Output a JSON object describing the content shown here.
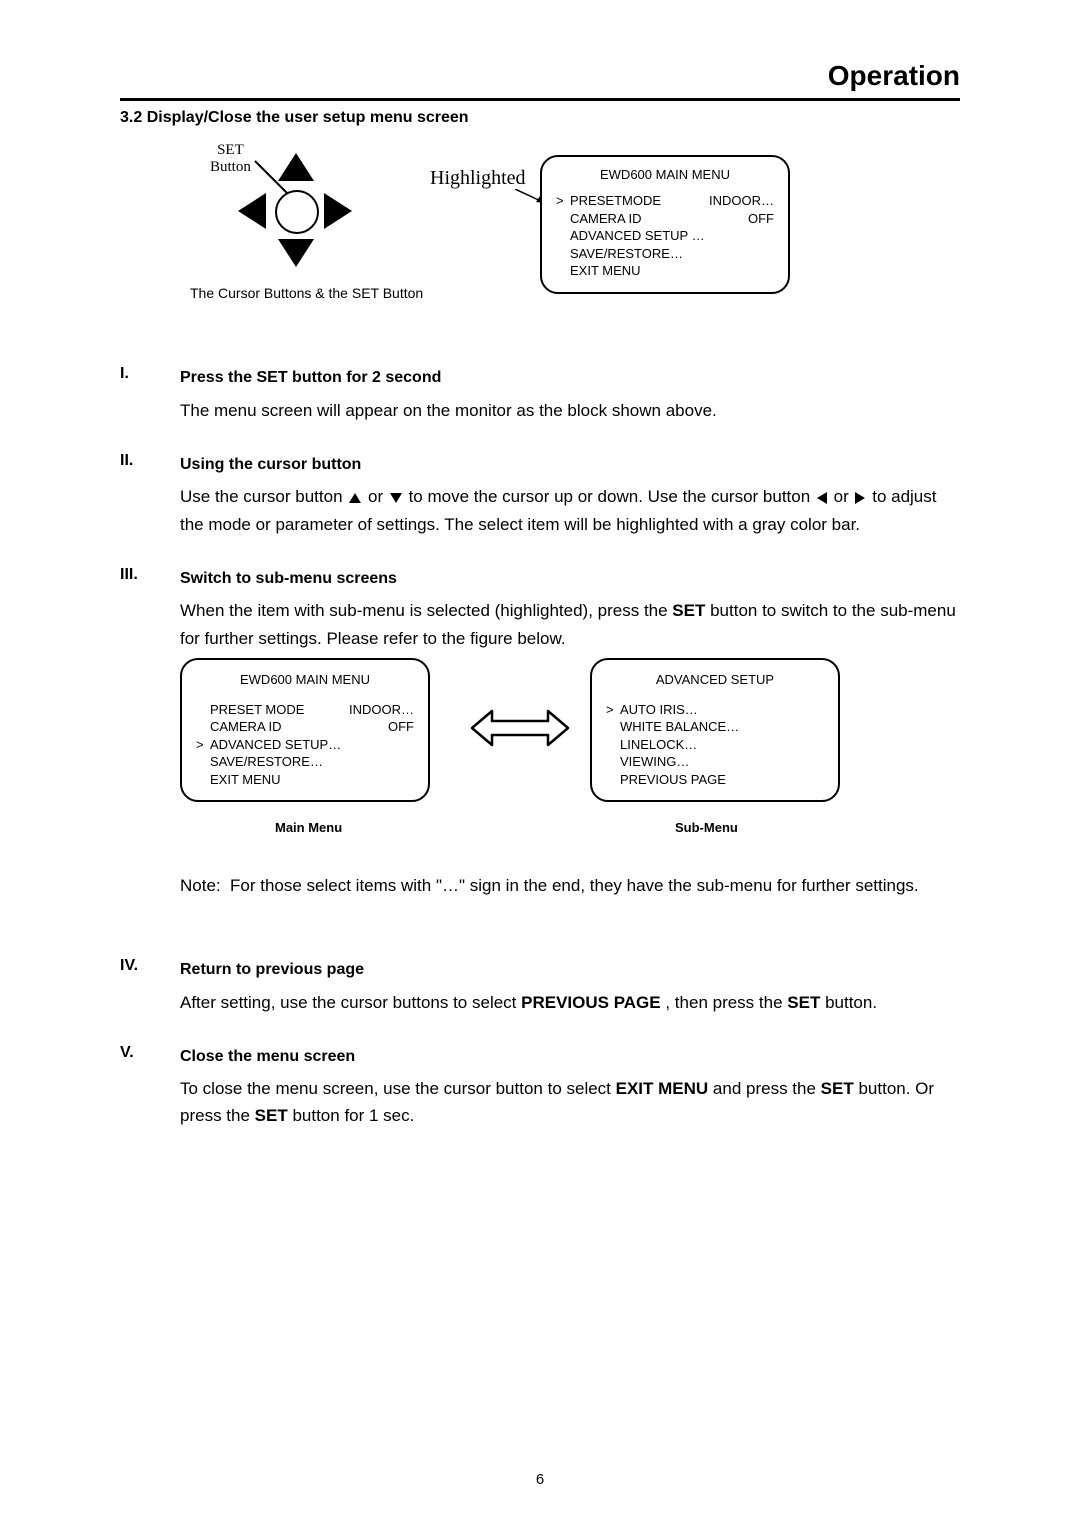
{
  "page_title": "Operation",
  "section_heading": "3.2 Display/Close the user setup menu screen",
  "figure_top": {
    "set_button_label_line1": "SET",
    "set_button_label_line2": "Button",
    "pad_caption": "The Cursor Buttons & the SET Button",
    "highlighted_label": "Highlighted",
    "menu": {
      "title": "EWD600 MAIN MENU",
      "rows": [
        {
          "caret": ">",
          "label": "PRESETMODE",
          "value": "INDOOR…"
        },
        {
          "caret": "",
          "label": "CAMERA ID",
          "value": "OFF"
        },
        {
          "caret": "",
          "label": "ADVANCED SETUP …",
          "value": ""
        },
        {
          "caret": "",
          "label": "SAVE/RESTORE…",
          "value": ""
        },
        {
          "caret": "",
          "label": "EXIT MENU",
          "value": ""
        }
      ]
    }
  },
  "steps": {
    "i": {
      "num": "I.",
      "head": "Press the SET button for 2 second",
      "body": "The menu screen will appear on the monitor as the block shown above."
    },
    "ii": {
      "num": "II.",
      "head": "Using the cursor button",
      "body_pre": "Use the cursor button ",
      "body_mid1": " or ",
      "body_mid2": " to move the cursor up or down. Use the cursor button ",
      "body_mid3": " or ",
      "body_post": " to adjust the mode or parameter of settings. The select item will be highlighted with a gray color bar."
    },
    "iii": {
      "num": "III.",
      "head": "Switch to sub-menu screens",
      "body_pre": "When the item with sub-menu is selected (highlighted), press the ",
      "set_word": "SET",
      "body_post": " button to switch to the sub-menu for further settings. Please refer to the figure below."
    },
    "iv": {
      "num": "IV.",
      "head": "Return to previous page",
      "body_pre": "After setting, use the cursor buttons to select ",
      "prev_page": "PREVIOUS PAGE",
      "body_mid": ", then press the ",
      "set_word": "SET",
      "body_post": " button."
    },
    "v": {
      "num": "V.",
      "head": "Close the menu screen",
      "body_pre": "To close the menu screen, use the cursor button to select ",
      "exit_menu": "EXIT MENU",
      "body_mid": " and press the ",
      "set1": "SET",
      "body_mid2": " button. Or press the ",
      "set2": "SET",
      "body_post": " button for 1 sec."
    }
  },
  "figure_mid": {
    "left_menu": {
      "title": "EWD600 MAIN MENU",
      "rows": [
        {
          "caret": "",
          "label": "PRESET MODE",
          "value": "INDOOR…"
        },
        {
          "caret": "",
          "label": "CAMERA ID",
          "value": "OFF"
        },
        {
          "caret": ">",
          "label": "ADVANCED SETUP…",
          "value": ""
        },
        {
          "caret": "",
          "label": "SAVE/RESTORE…",
          "value": ""
        },
        {
          "caret": "",
          "label": "EXIT MENU",
          "value": ""
        }
      ]
    },
    "right_menu": {
      "title": "ADVANCED SETUP",
      "rows": [
        {
          "caret": ">",
          "label": "AUTO IRIS…",
          "value": ""
        },
        {
          "caret": "",
          "label": "WHITE BALANCE…",
          "value": ""
        },
        {
          "caret": "",
          "label": "LINELOCK…",
          "value": ""
        },
        {
          "caret": "",
          "label": "VIEWING…",
          "value": ""
        },
        {
          "caret": "",
          "label": "PREVIOUS PAGE",
          "value": ""
        }
      ]
    },
    "caption_left": "Main Menu",
    "caption_right": "Sub-Menu"
  },
  "note": {
    "label": "Note:",
    "body": "For those select items with \"…\" sign in the end, they have the sub-menu for further settings."
  },
  "page_number": "6"
}
